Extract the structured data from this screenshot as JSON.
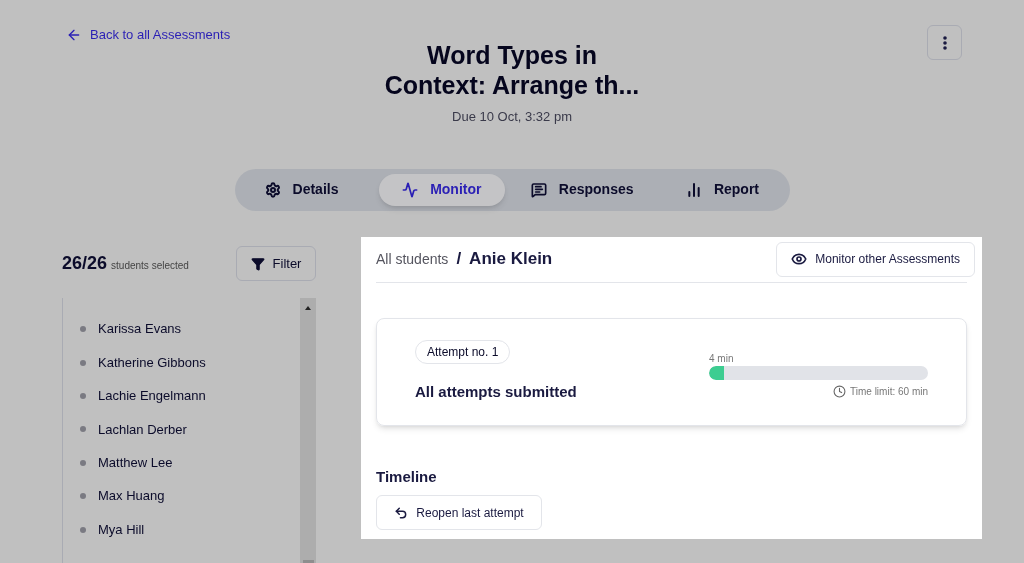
{
  "back_link": "Back to all Assessments",
  "title": "Word Types in Context: Arrange th...",
  "due": "Due 10 Oct, 3:32 pm",
  "tabs": [
    {
      "label": "Details",
      "selected": false
    },
    {
      "label": "Monitor",
      "selected": true
    },
    {
      "label": "Responses",
      "selected": false
    },
    {
      "label": "Report",
      "selected": false
    }
  ],
  "students": {
    "count": "26/26",
    "count_label": "students selected",
    "filter_button": "Filter",
    "items": [
      "Karissa Evans",
      "Katherine Gibbons",
      "Lachie Engelmann",
      "Lachlan Derber",
      "Matthew Lee",
      "Max Huang",
      "Mya Hill"
    ]
  },
  "breadcrumb": {
    "parent": "All students",
    "separator": "/",
    "current": "Anie Klein"
  },
  "monitor_button": "Monitor other Assessments",
  "attempt": {
    "badge": "Attempt no. 1",
    "status": "All attempts submitted",
    "elapsed": "4 min",
    "level": 0.07,
    "time_limit": "Time limit: 60 min"
  },
  "timeline": {
    "heading": "Timeline",
    "reopen_button": "Reopen last attempt"
  }
}
